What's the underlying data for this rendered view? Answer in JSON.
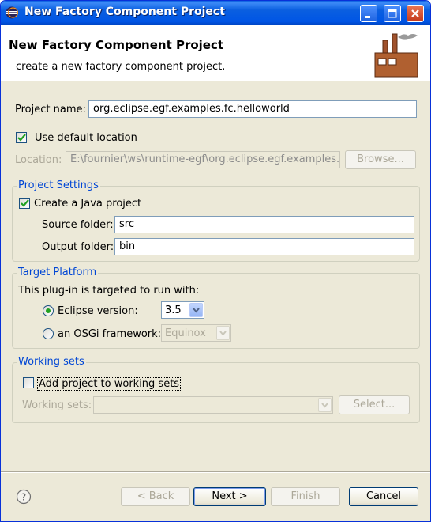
{
  "window": {
    "title": "New Factory Component Project"
  },
  "header": {
    "title": "New Factory Component Project",
    "description": "create a new factory component project."
  },
  "project_name": {
    "label": "Project name:",
    "value": "org.eclipse.egf.examples.fc.helloworld"
  },
  "default_location": {
    "label": "Use default location",
    "checked": true
  },
  "location": {
    "label": "Location:",
    "value": "E:\\fournier\\ws\\runtime-egf\\org.eclipse.egf.examples.fc.",
    "browse_label": "Browse..."
  },
  "project_settings": {
    "title": "Project Settings",
    "java_project_label": "Create a Java project",
    "java_project_checked": true,
    "source_folder_label": "Source folder:",
    "source_folder_value": "src",
    "output_folder_label": "Output folder:",
    "output_folder_value": "bin"
  },
  "target_platform": {
    "title": "Target Platform",
    "description": "This plug-in is targeted to run with:",
    "eclipse_label": "Eclipse version:",
    "eclipse_selected": true,
    "eclipse_version": "3.5",
    "osgi_label": "an OSGi framework:",
    "osgi_value": "Equinox"
  },
  "working_sets": {
    "title": "Working sets",
    "add_label": "Add project to working sets",
    "add_checked": false,
    "sets_label": "Working sets:",
    "sets_value": "",
    "select_label": "Select..."
  },
  "buttons": {
    "back": "< Back",
    "next": "Next >",
    "finish": "Finish",
    "cancel": "Cancel"
  },
  "colors": {
    "titlebar": "#0a5fe0",
    "dialog_bg": "#ece9d8",
    "group_title": "#0046d5",
    "check": "#21a121"
  }
}
